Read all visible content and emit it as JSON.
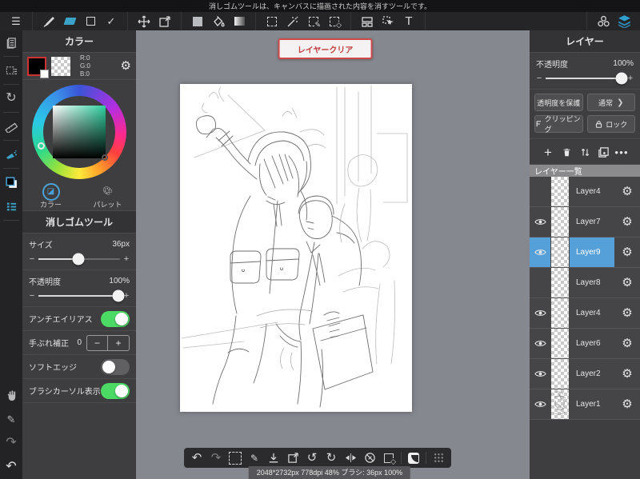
{
  "app": {
    "message": "消しゴムツールは、キャンバスに描画された内容を消すツールです。",
    "text_tool_label": "T"
  },
  "ui": {
    "minus": "−",
    "plus": "+",
    "more": "・・・",
    "chevron": "❭"
  },
  "color_panel": {
    "title": "カラー",
    "rgb": {
      "r": "R:0",
      "g": "G:0",
      "b": "B:0"
    },
    "tabs": [
      {
        "label": "カラー"
      },
      {
        "label": "パレット"
      }
    ]
  },
  "tool_panel": {
    "title": "消しゴムツール",
    "size_label": "サイズ",
    "size_value": "36px",
    "opacity_label": "不透明度",
    "opacity_value": "100%",
    "antialias_label": "アンチエイリアス",
    "stabilize_label": "手ぶれ補正",
    "stabilize_value": "0",
    "soft_edge_label": "ソフトエッジ",
    "brush_cursor_label": "ブラシカーソル表示"
  },
  "sliders": {
    "tool_size": 48,
    "tool_opacity": 97,
    "layer_opacity": 96
  },
  "stage": {
    "clear_button": "レイヤークリア",
    "status": "2048*2732px 778dpi 48% ブラシ: 36px 100%"
  },
  "layer_panel": {
    "title": "レイヤー",
    "opacity_label": "不透明度",
    "opacity_value": "100%",
    "protect_button": "透明度を保護",
    "blend_button": "通常",
    "clipping_button": "クリッピング",
    "lock_button": "ロック",
    "list_header": "レイヤー一覧",
    "layers": [
      {
        "name": "Layer4",
        "visible": false,
        "selected": false,
        "thumb": "empty"
      },
      {
        "name": "Layer7",
        "visible": true,
        "selected": false,
        "thumb": "empty"
      },
      {
        "name": "Layer9",
        "visible": true,
        "selected": true,
        "thumb": "empty"
      },
      {
        "name": "Layer8",
        "visible": false,
        "selected": false,
        "thumb": "empty"
      },
      {
        "name": "Layer4",
        "visible": true,
        "selected": false,
        "thumb": "empty"
      },
      {
        "name": "Layer6",
        "visible": true,
        "selected": false,
        "thumb": "empty"
      },
      {
        "name": "Layer2",
        "visible": true,
        "selected": false,
        "thumb": "empty"
      },
      {
        "name": "Layer1",
        "visible": true,
        "selected": false,
        "thumb": "sketch"
      }
    ]
  }
}
